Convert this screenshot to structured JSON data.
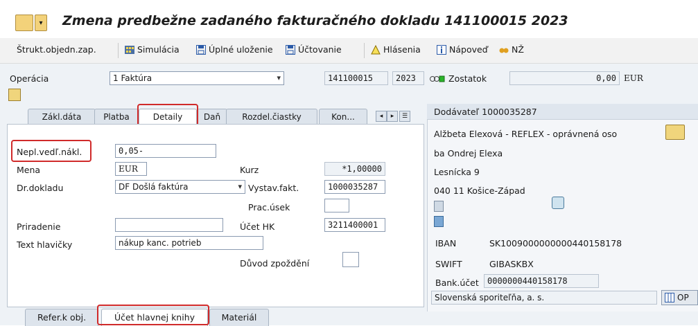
{
  "window": {
    "title": "Zmena predbežne zadaného fakturačného dokladu 141100015 2023"
  },
  "toolbar": {
    "items": [
      {
        "label": "Štrukt.objedn.zap.",
        "icon": ""
      },
      {
        "label": "Simulácia",
        "icon": "simulation-icon"
      },
      {
        "label": "Úplné uloženie",
        "icon": "save-icon"
      },
      {
        "label": "Účtovanie",
        "icon": "post-icon"
      },
      {
        "label": "Hlásenia",
        "icon": "warning-icon"
      },
      {
        "label": "Nápoveď",
        "icon": "info-icon"
      },
      {
        "label": "NŽ",
        "icon": "glasses-icon"
      }
    ]
  },
  "header": {
    "operation_label": "Operácia",
    "operation_value": "1 Faktúra",
    "doc_number": "141100015",
    "doc_year": "2023",
    "balance_label": "Zostatok",
    "balance_value": "0,00",
    "balance_currency": "EUR"
  },
  "tabs": [
    {
      "label": "Zákl.dáta"
    },
    {
      "label": "Platba"
    },
    {
      "label": "Detaily"
    },
    {
      "label": "Daň"
    },
    {
      "label": "Rozdel.čiastky"
    },
    {
      "label": "Kon..."
    }
  ],
  "details": {
    "nepl_label": "Nepl.vedľ.nákl.",
    "nepl_value": "0,05-",
    "mena_label": "Mena",
    "mena_value": "EUR",
    "kurz_label": "Kurz",
    "kurz_value": "*1,00000",
    "drdokladu_label": "Dr.dokladu",
    "drdokladu_value": "DF Došlá faktúra",
    "vystav_label": "Vystav.fakt.",
    "vystav_value": "1000035287",
    "pracusek_label": "Prac.úsek",
    "pracusek_value": "",
    "priradenie_label": "Priradenie",
    "priradenie_value": "",
    "uctohk_label": "Účet HK",
    "uctohk_value": "3211400001",
    "text_label": "Text hlavičky",
    "text_value": "nákup kanc. potrieb",
    "duvod_label": "Důvod zpoždění"
  },
  "vendor": {
    "header": "Dodávateľ 1000035287",
    "name_line1": "Alžbeta Elexová - REFLEX - oprávnená oso",
    "name_line2": "ba Ondrej Elexa",
    "street": "Lesnícka 9",
    "city": "040 11 Košice-Západ",
    "iban_label": "IBAN",
    "iban_value": "SK1009000000000440158178",
    "swift_label": "SWIFT",
    "swift_value": "GIBASKBX",
    "bank_acc_label": "Bank.účet",
    "bank_acc_value": "0000000440158178",
    "bank_name": "Slovenská sporiteľňa, a. s.",
    "op_label": "OP"
  },
  "bottom_tabs": [
    {
      "label": "Refer.k obj."
    },
    {
      "label": "Účet hlavnej knihy"
    },
    {
      "label": "Materiál"
    }
  ],
  "colors": {
    "highlight": "#d02a2a",
    "background": "#eef2f6"
  }
}
